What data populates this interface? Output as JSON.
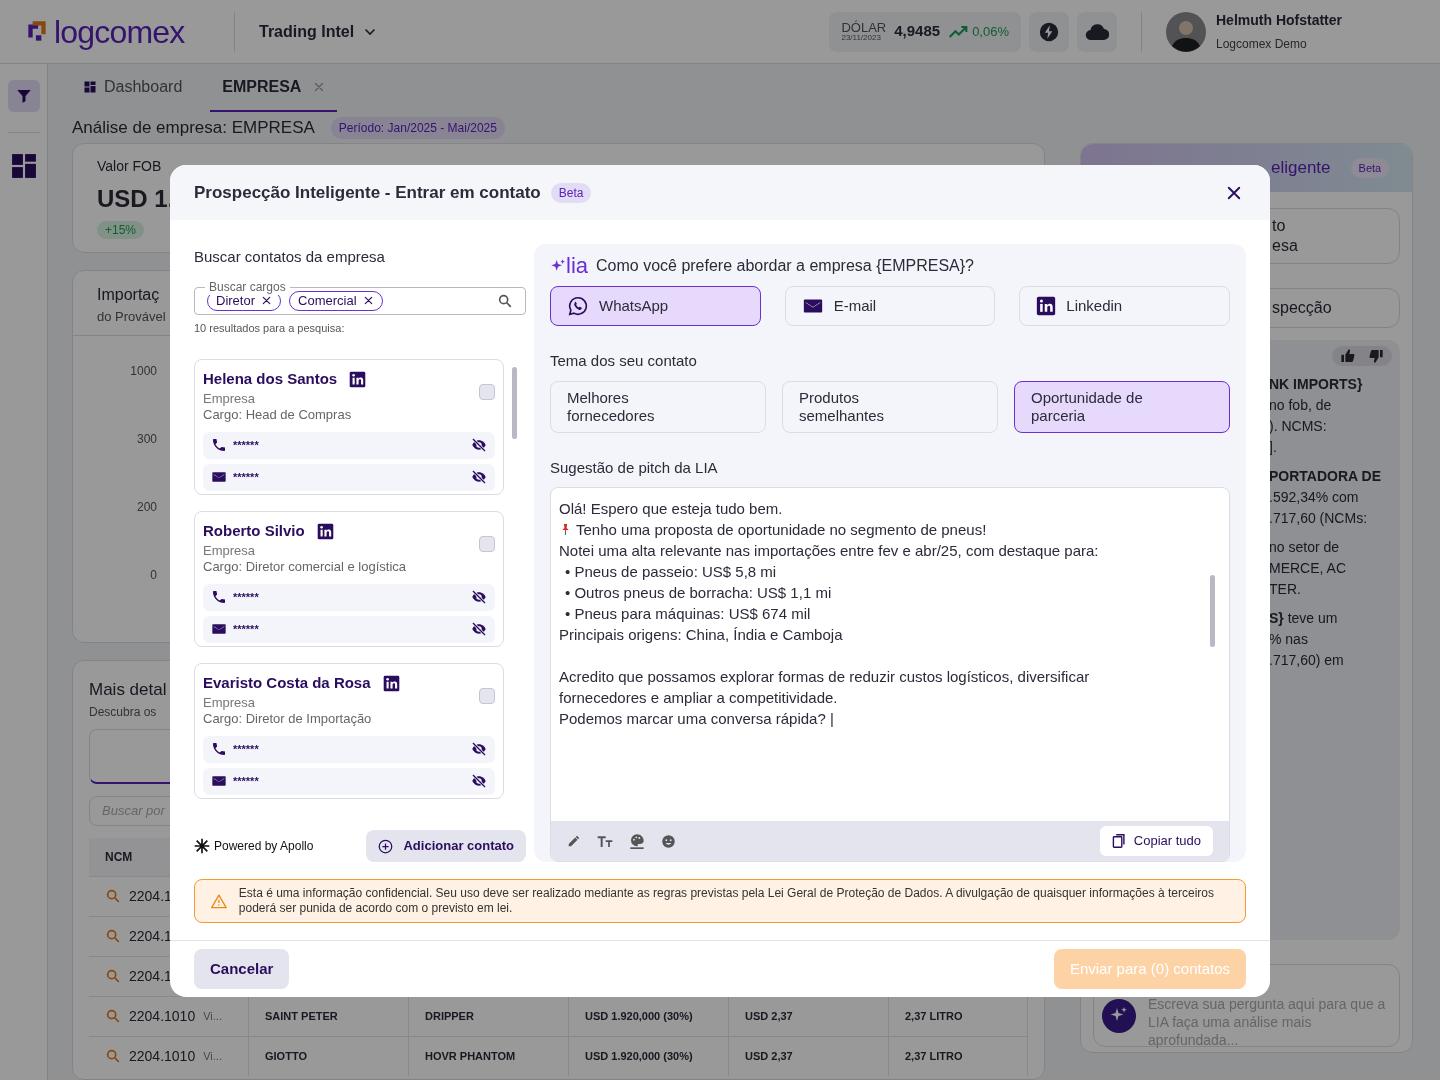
{
  "header": {
    "logo": "logcomex",
    "product": "Trading Intel",
    "currency": {
      "label": "DÓLAR",
      "date": "23/11/2023",
      "value": "4,9485",
      "change": "0,06%"
    },
    "user": {
      "name": "Helmuth Hofstatter",
      "org": "Logcomex Demo"
    }
  },
  "tabs": [
    {
      "label": "Dashboard",
      "selected": false,
      "closable": false
    },
    {
      "label": "EMPRESA",
      "selected": true,
      "closable": true
    }
  ],
  "page": {
    "title": "Análise de empresa: EMPRESA",
    "period": "Período: Jan/2025 - Mai/2025"
  },
  "background": {
    "fob_card": {
      "label": "Valor FOB",
      "value": "USD 1.",
      "change": "+15%"
    },
    "import_card": {
      "title": "Importaç",
      "subtitle": "do Provável",
      "ticks": [
        "1000",
        "300",
        "200",
        "0"
      ]
    },
    "details": {
      "title": "Mais detal",
      "subtitle": "Descubra os",
      "search_placeholder": "Buscar por",
      "column": "NCM",
      "rows": [
        {
          "ncm": "2204.1"
        },
        {
          "ncm": "2204.1"
        },
        {
          "ncm": "2204.1"
        },
        {
          "ncm": "2204.1010",
          "desc": "Vi...",
          "cells": [
            "SAINT PETER",
            "DRIPPER",
            "USD 1.920,000 (30%)",
            "USD 2,37",
            "2,37 LITRO"
          ]
        },
        {
          "ncm": "2204.1010",
          "desc": "Vi...",
          "cells": [
            "GIOTTO",
            "HOVR PHANTOM",
            "USD 1.920,000 (30%)",
            "USD 2,37",
            "2,37 LITRO"
          ]
        }
      ]
    },
    "lia_panel": {
      "title": "eligente",
      "badge": "Beta",
      "options": [
        "to\nesa",
        "specção"
      ],
      "answer": [
        "**NK IMPORTS}**\nno fob, de\n). NCMS:\n].",
        "**PORTADORA DE**\n.592,34% com\n.717,60 (NCMs:",
        "no setor de\nMERCE, AC\nTER.",
        "**S}** teve um\n% nas\n.717,60) em"
      ],
      "input_placeholder": "Escreva sua pergunta aqui para que a LIA faça uma análise mais aprofundada..."
    }
  },
  "modal": {
    "title": "Prospecção Inteligente - Entrar em contato",
    "badge": "Beta",
    "contacts_panel": {
      "heading": "Buscar contatos da empresa",
      "search": {
        "label": "Buscar cargos",
        "chips": [
          "Diretor",
          "Comercial"
        ]
      },
      "result_count": "10 resultados para a pesquisa:",
      "contacts": [
        {
          "name": "Helena dos Santos",
          "company": "Empresa",
          "role": "Cargo: Head de Compras",
          "checked": false,
          "phone": "******",
          "email": "******"
        },
        {
          "name": "Roberto Silvio",
          "company": "Empresa",
          "role": "Cargo: Diretor comercial e logística",
          "checked": false,
          "phone": "******",
          "email": "******"
        },
        {
          "name": "Evaristo Costa da Rosa",
          "company": "Empresa",
          "role": "Cargo: Diretor de Importação",
          "checked": false,
          "phone": "******",
          "email": "******"
        }
      ],
      "powered_by": "Powered by Apollo",
      "add_button": "Adicionar contato"
    },
    "lia": {
      "logo": "lia",
      "question": "Como você prefere abordar a empresa {EMPRESA}?",
      "channels": [
        {
          "kind": "whatsapp",
          "label": "WhatsApp",
          "selected": true
        },
        {
          "kind": "email",
          "label": "E-mail",
          "selected": false
        },
        {
          "kind": "linkedin",
          "label": "Linkedin",
          "selected": false
        }
      ],
      "topic_heading": "Tema dos seu contato",
      "topics": [
        {
          "label": "Melhores fornecedores",
          "selected": false
        },
        {
          "label": "Produtos semelhantes",
          "selected": false
        },
        {
          "label": "Oportunidade de parceria",
          "selected": true
        }
      ],
      "pitch_heading": "Sugestão de pitch da LIA",
      "pitch": [
        {
          "kind": "plain",
          "text": "Olá! Espero que esteja tudo bem."
        },
        {
          "kind": "pin",
          "text": "Tenho uma proposta de oportunidade no segmento de pneus!"
        },
        {
          "kind": "plain",
          "text": "Notei uma alta relevante nas importações entre fev e abr/25, com destaque para:"
        },
        {
          "kind": "bullet",
          "text": "•  Pneus de passeio: US$ 5,8 mi"
        },
        {
          "kind": "bullet",
          "text": "•  Outros pneus de borracha: US$ 1,1 mi"
        },
        {
          "kind": "bullet",
          "text": "•  Pneus para máquinas: US$ 674 mil"
        },
        {
          "kind": "plain",
          "text": "Principais origens: China, Índia e Camboja"
        },
        {
          "kind": "blank"
        },
        {
          "kind": "plain",
          "text": "Acredito que possamos explorar formas de reduzir custos logísticos, diversificar fornecedores e ampliar a competitividade."
        },
        {
          "kind": "plain",
          "text": "Podemos marcar uma conversa rápida? |"
        }
      ],
      "copy_button": "Copiar tudo"
    },
    "warning": "Esta é uma informação confidencial. Seu uso deve ser realizado mediante as regras previstas pela Lei Geral de Proteção de Dados. A divulgação de quaisquer informações à terceiros poderá ser punida de acordo com o previsto em lei.",
    "cancel": "Cancelar",
    "send": {
      "label": "Enviar para (0) contatos",
      "disabled": true
    }
  }
}
